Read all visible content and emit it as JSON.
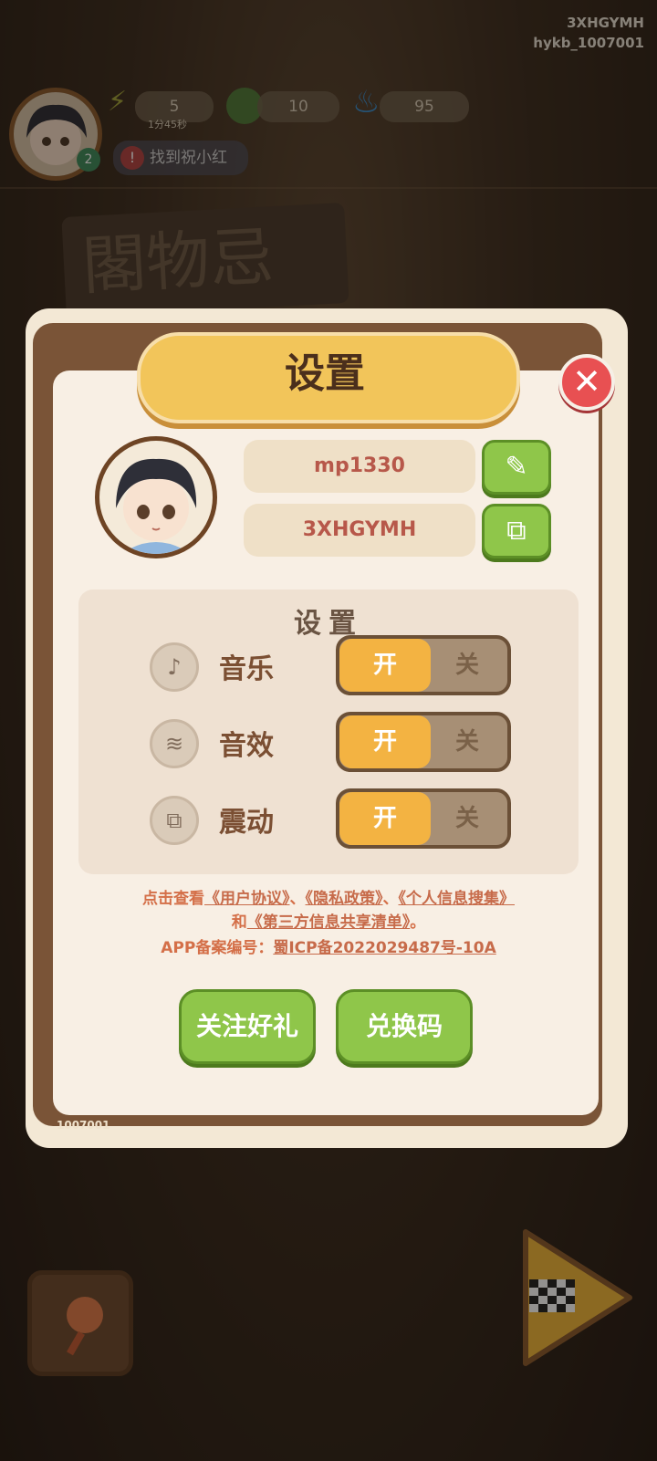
{
  "corner": {
    "code": "3XHGYMH",
    "account": "hykb_1007001"
  },
  "hud": {
    "level": "2",
    "energy": "5",
    "energy_timer": "1分45秒",
    "coins": "10",
    "flame": "95",
    "quest": "找到祝小红"
  },
  "background": {
    "sign_text": "閣物忌"
  },
  "dialog": {
    "title": "设置",
    "close_label": "✕",
    "username": "mp1330",
    "user_code": "3XHGYMH",
    "edit_icon": "pencil-icon",
    "copy_icon": "copy-icon",
    "settings_title": "设置",
    "rows": [
      {
        "label": "音乐",
        "on": "开",
        "off": "关",
        "icon": "♪"
      },
      {
        "label": "音效",
        "on": "开",
        "off": "关",
        "icon": "≋"
      },
      {
        "label": "震动",
        "on": "开",
        "off": "关",
        "icon": "⧉"
      }
    ],
    "legal": {
      "prefix": "点击查看",
      "user_agreement": "《用户协议》",
      "sep1": "、",
      "privacy_policy": "《隐私政策》",
      "sep2": "、",
      "personal_info": "《个人信息搜集》",
      "and": "和",
      "third_party": "《第三方信息共享清单》",
      "end": "。",
      "icp_label": "APP备案编号：",
      "icp_number": "蜀ICP备2022029487号-10A"
    },
    "follow_button": "关注好礼",
    "redeem_button": "兑换码",
    "build_id": "1007001"
  }
}
